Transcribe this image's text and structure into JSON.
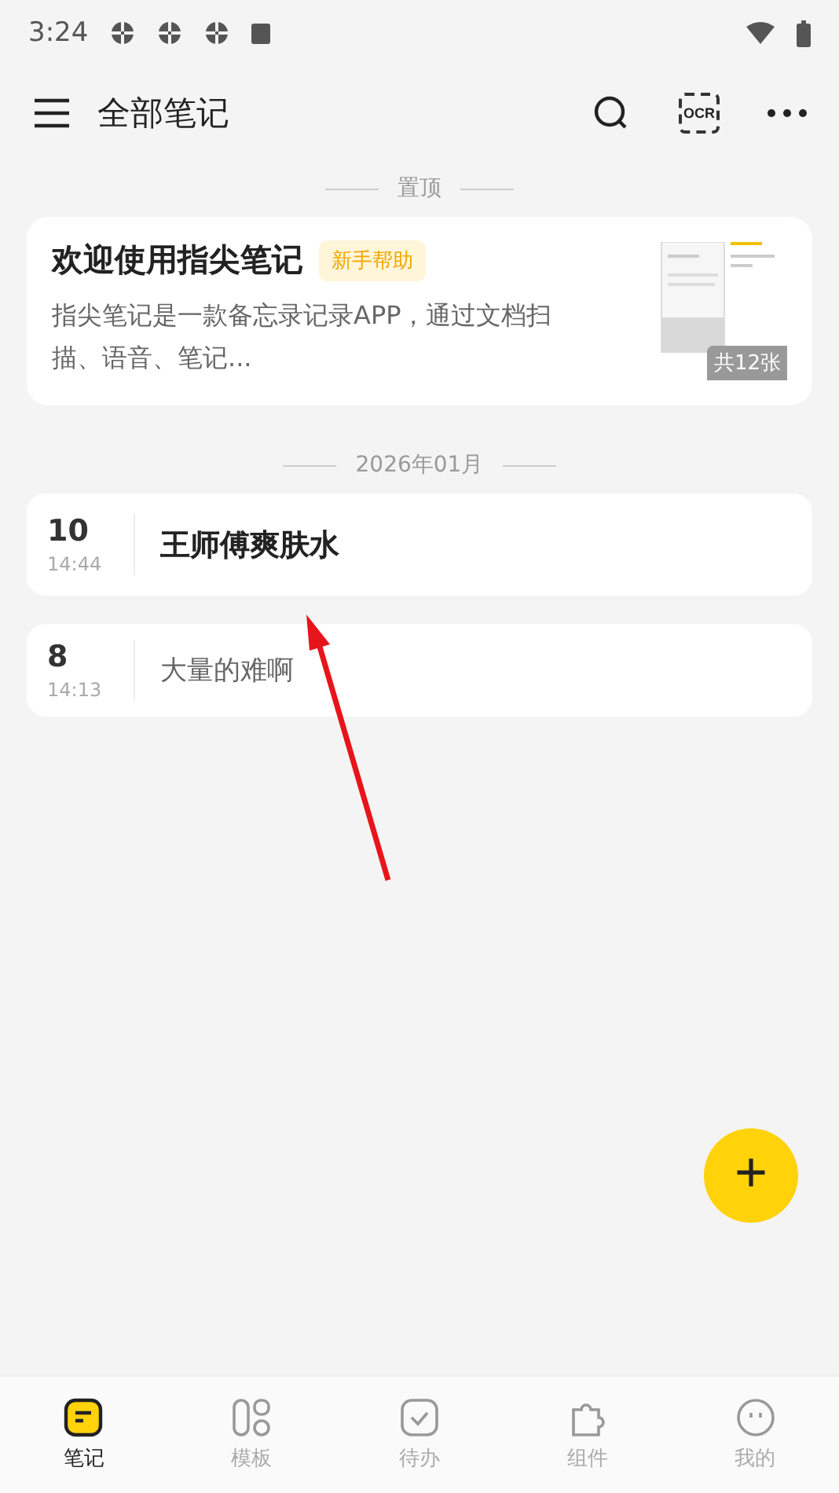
{
  "status_bar": {
    "time": "3:24"
  },
  "header": {
    "title": "全部笔记",
    "ocr_label": "OCR"
  },
  "pinned_section": {
    "label": "置顶"
  },
  "pinned_card": {
    "title": "欢迎使用指尖笔记",
    "tag": "新手帮助",
    "summary": "指尖笔记是一款备忘录记录APP，通过文档扫描、语音、笔记...",
    "thumbnail": {
      "kind": "picture",
      "count": "共12张"
    }
  },
  "month_section": {
    "label": "2026年01月"
  },
  "notes": [
    {
      "day": "10",
      "time": "14:44",
      "title": "王师傅爽肤水",
      "bold": true
    },
    {
      "day": "8",
      "time": "14:13",
      "title": "大量的难啊",
      "bold": false
    }
  ],
  "fab": {
    "label": "+"
  },
  "bottom_nav": [
    {
      "label": "笔记",
      "kind": "note",
      "selected": true
    },
    {
      "label": "模板",
      "kind": "template",
      "selected": false
    },
    {
      "label": "待办",
      "kind": "todo",
      "selected": false
    },
    {
      "label": "组件",
      "kind": "widget",
      "selected": false
    },
    {
      "label": "我的",
      "kind": "me",
      "selected": false
    }
  ]
}
